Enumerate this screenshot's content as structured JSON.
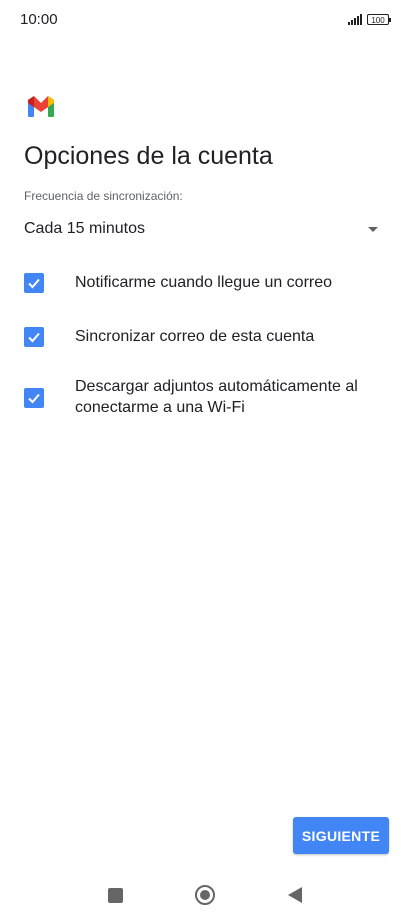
{
  "status_bar": {
    "time": "10:00",
    "battery": "100"
  },
  "header": {
    "logo_icon": "gmail-logo-icon",
    "title": "Opciones de la cuenta"
  },
  "sync_frequency": {
    "label": "Frecuencia de sincronización:",
    "selected": "Cada 15 minutos"
  },
  "options": [
    {
      "label": "Notificarme cuando llegue un correo",
      "checked": true
    },
    {
      "label": "Sincronizar correo de esta cuenta",
      "checked": true
    },
    {
      "label": "Descargar adjuntos automáticamente al conectarme a una Wi-Fi",
      "checked": true
    }
  ],
  "actions": {
    "next_label": "SIGUIENTE"
  },
  "colors": {
    "accent": "#4285f4",
    "text": "#202124",
    "secondary_text": "#5f6368"
  },
  "nav": {
    "recents_icon": "square-icon",
    "home_icon": "circle-icon",
    "back_icon": "triangle-back-icon"
  }
}
